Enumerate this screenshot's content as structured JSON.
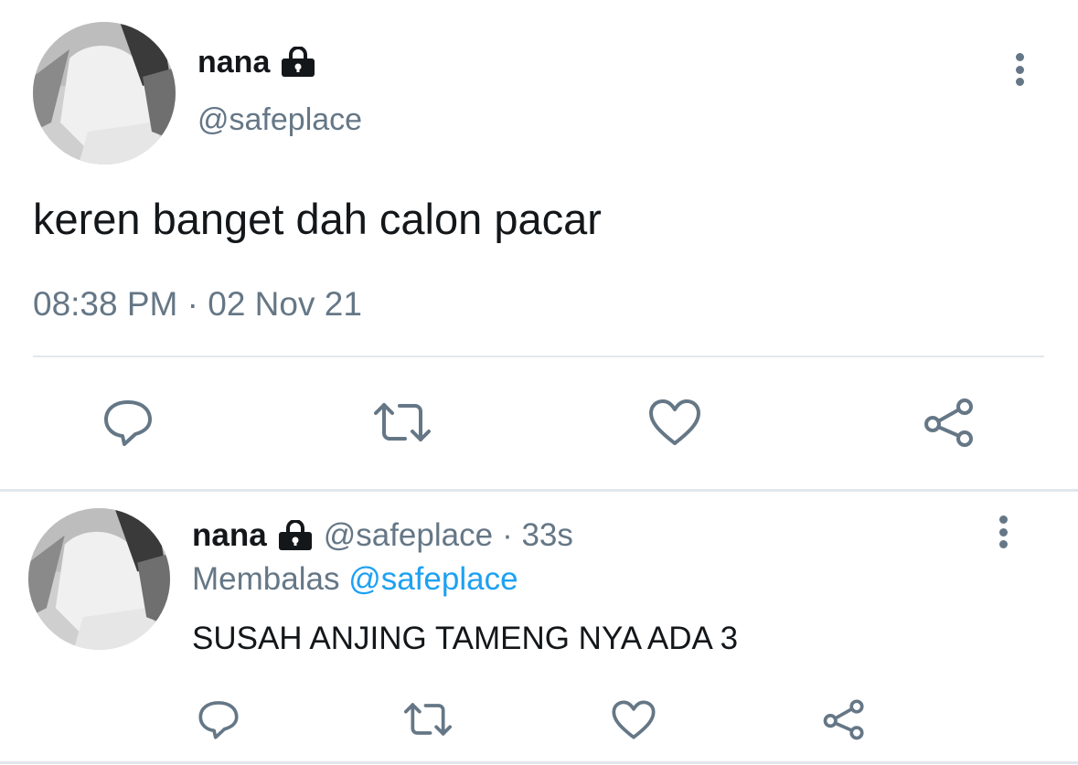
{
  "main_tweet": {
    "author_name": "nana",
    "author_handle": "@safeplace",
    "text": "keren banget dah calon pacar",
    "timestamp": "08:38 PM · 02 Nov 21",
    "icons": {
      "lock": "lock-icon",
      "more": "more-vertical-icon",
      "reply": "reply-icon",
      "retweet": "retweet-icon",
      "like": "heart-icon",
      "share": "share-icon"
    }
  },
  "reply_tweet": {
    "author_name": "nana",
    "author_handle": "@safeplace",
    "age": "· 33s",
    "replying_prefix": "Membalas",
    "replying_to": "@safeplace",
    "text": "SUSAH ANJING TAMENG NYA ADA 3"
  },
  "colors": {
    "text": "#14171a",
    "secondary": "#657786",
    "link": "#1da1f2",
    "divider": "#e1e8ed"
  }
}
